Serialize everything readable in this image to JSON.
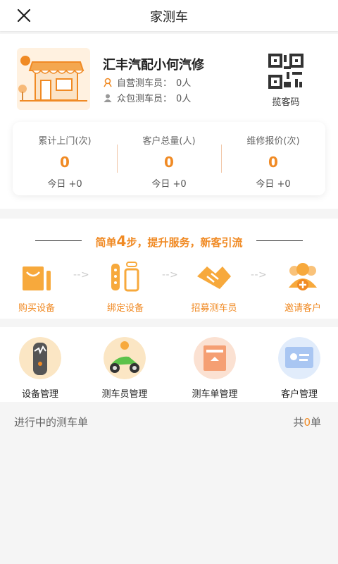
{
  "nav": {
    "title": "家测车"
  },
  "store": {
    "name": "汇丰汽配小何汽修",
    "self_label": "自营测车员：",
    "self_count": "0人",
    "crowd_label": "众包测车员：",
    "crowd_count": "0人",
    "qr_label": "揽客码"
  },
  "stats": [
    {
      "label": "累计上门(次)",
      "value": "0",
      "today": "今日 +0"
    },
    {
      "label": "客户总量(人)",
      "value": "0",
      "today": "今日 +0"
    },
    {
      "label": "维修报价(次)",
      "value": "0",
      "today": "今日 +0"
    }
  ],
  "steps": {
    "title_pre": "简单",
    "title_num": "4",
    "title_post": "步，提升服务，新客引流",
    "items": [
      {
        "label": "购买设备",
        "icon": "shopping-bag-icon"
      },
      {
        "label": "绑定设备",
        "icon": "bind-device-icon"
      },
      {
        "label": "招募测车员",
        "icon": "handshake-icon"
      },
      {
        "label": "邀请客户",
        "icon": "invite-user-icon"
      }
    ]
  },
  "management": [
    {
      "label": "设备管理",
      "icon": "device-icon"
    },
    {
      "label": "测车员管理",
      "icon": "scooter-icon"
    },
    {
      "label": "测车单管理",
      "icon": "order-icon"
    },
    {
      "label": "客户管理",
      "icon": "customer-card-icon"
    }
  ],
  "orders": {
    "title": "进行中的测车单",
    "count_pre": "共",
    "count": "0",
    "count_post": "单"
  },
  "colors": {
    "accent": "#f08a24",
    "background": "#f5f5f5"
  }
}
